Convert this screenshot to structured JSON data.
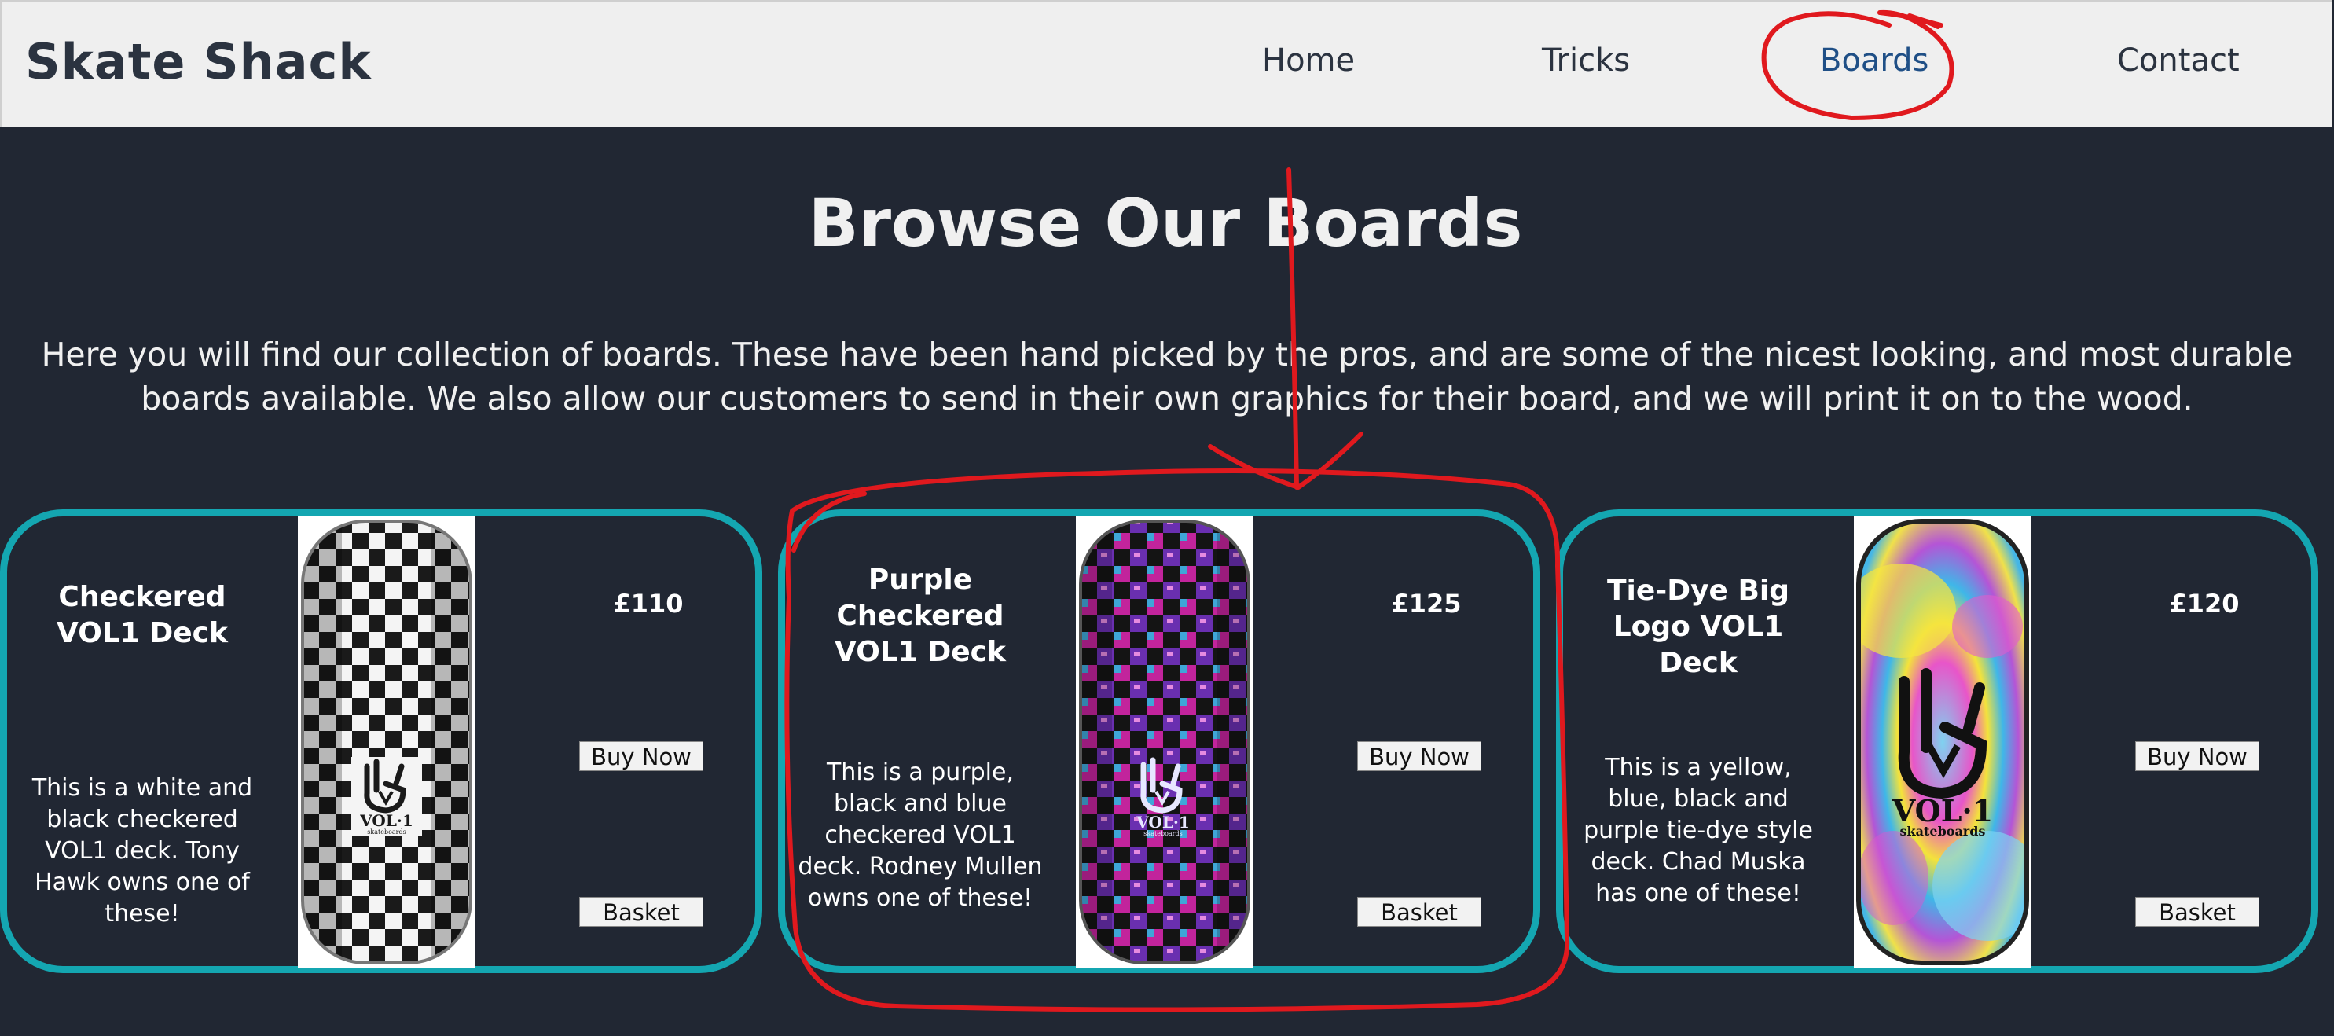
{
  "nav": {
    "brand": "Skate Shack",
    "links": [
      {
        "label": "Home",
        "active": false
      },
      {
        "label": "Tricks",
        "active": false
      },
      {
        "label": "Boards",
        "active": true
      },
      {
        "label": "Contact",
        "active": false
      }
    ]
  },
  "page": {
    "title": "Browse Our Boards",
    "intro": "Here you will find our collection of boards. These have been hand picked by the pros, and are some of the nicest looking, and most durable boards available. We also allow our customers to send in their own graphics for their board, and we will print it on to the wood."
  },
  "products": [
    {
      "name": "Checkered VOL1 Deck",
      "price": "£110",
      "description": "This is a white and black checkered VOL1 deck. Tony Hawk owns one of these!",
      "buy_label": "Buy Now",
      "basket_label": "Basket",
      "image_logo": "VOL·1",
      "image_logo_sub": "skateboards",
      "image_style": "white-black-checkered"
    },
    {
      "name": "Purple Checkered VOL1 Deck",
      "price": "£125",
      "description": "This is a purple, black and blue checkered VOL1 deck. Rodney Mullen owns one of these!",
      "buy_label": "Buy Now",
      "basket_label": "Basket",
      "image_logo": "VOL·1",
      "image_logo_sub": "skateboards",
      "image_style": "purple-black-checkered"
    },
    {
      "name": "Tie-Dye Big Logo VOL1 Deck",
      "price": "£120",
      "description": "This is a yellow, blue, black and purple tie-dye style deck. Chad Muska has one of these!",
      "buy_label": "Buy Now",
      "basket_label": "Basket",
      "image_logo": "VOL·1",
      "image_logo_sub": "skateboards",
      "image_style": "tie-dye"
    }
  ],
  "colors": {
    "background": "#212733",
    "navbar": "#efefef",
    "card_border": "#14a6b1",
    "active_link": "#1f4f86",
    "annotation": "#e0191e"
  }
}
